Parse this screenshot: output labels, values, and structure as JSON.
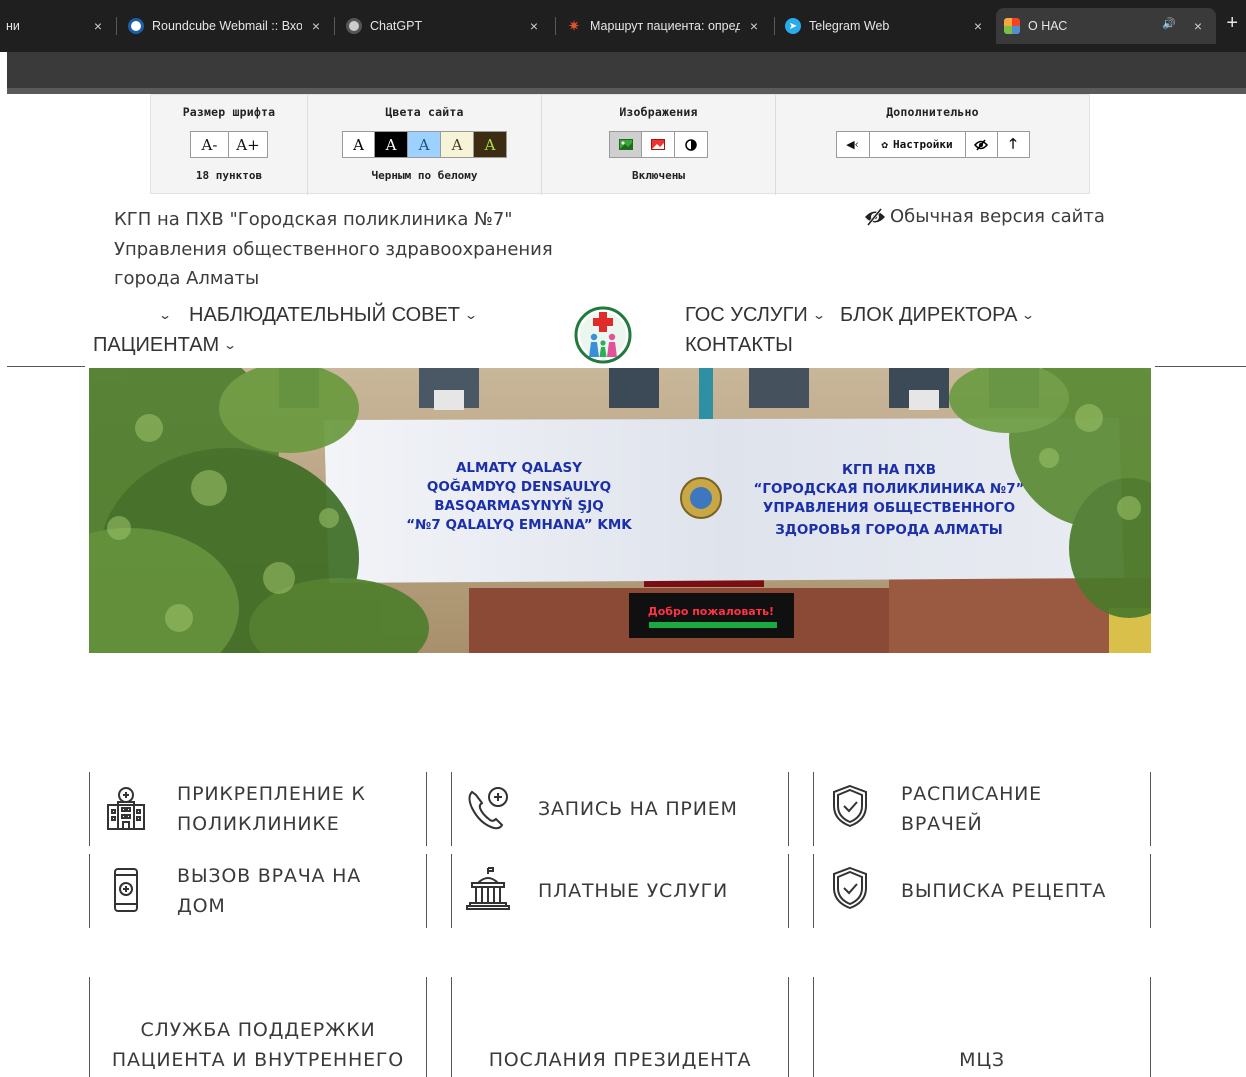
{
  "browser": {
    "tabs": [
      {
        "title": "ни",
        "favicon": "page-icon",
        "color": "#888888"
      },
      {
        "title": "Roundcube Webmail :: Вход",
        "favicon": "roundcube-icon",
        "color": "#1d5ea8"
      },
      {
        "title": "ChatGPT",
        "favicon": "chatgpt-icon",
        "color": "#cccccc"
      },
      {
        "title": "Маршрут пациента: определение",
        "favicon": "site-icon",
        "color": "#e0522a"
      },
      {
        "title": "Telegram Web",
        "favicon": "telegram-icon",
        "color": "#2aabee"
      },
      {
        "title": "О НАС",
        "favicon": "joomla-icon",
        "color": "#f44321"
      }
    ],
    "close_glyph": "×",
    "new_tab_glyph": "+",
    "audio_glyph": "🔊"
  },
  "accessibility": {
    "font_size": {
      "title": "Размер шрифта",
      "decrease": "A-",
      "increase": "A+",
      "status": "18 пунктов"
    },
    "colors": {
      "title": "Цвета сайта",
      "letter": "A",
      "status": "Черным по белому",
      "swatches": [
        {
          "bg": "#ffffff",
          "fg": "#000000"
        },
        {
          "bg": "#000000",
          "fg": "#ffffff"
        },
        {
          "bg": "#9dd1ff",
          "fg": "#1b4f86"
        },
        {
          "bg": "#f7f3d6",
          "fg": "#4b3a1e"
        },
        {
          "bg": "#3b2c12",
          "fg": "#a8e04a"
        }
      ]
    },
    "images": {
      "title": "Изображения",
      "status": "Включены"
    },
    "extra": {
      "title": "Дополнительно",
      "settings_label": "Настройки"
    }
  },
  "header": {
    "org_line1": "КГП на ПХВ \"Городская поликлиника №7\"",
    "org_line2": "Управления общественного здравоохранения",
    "org_line3": "города Алматы",
    "normal_version": "Обычная версия сайта"
  },
  "nav": {
    "council": "НАБЛЮДАТЕЛЬНЫЙ СОВЕТ",
    "patients": "ПАЦИЕНТАМ",
    "gov": "ГОС УСЛУГИ",
    "director": "БЛОК ДИРЕКТОРА",
    "contacts": "КОНТАКТЫ",
    "chevron": "⌄"
  },
  "hero": {
    "sign_left": [
      "ALMATY QALASY",
      "QOĞAMDYQ DENSAULYQ",
      "BASQARMASYNYŇ ŞJQ",
      "“№7 QALALYQ EMHANA” KMK"
    ],
    "sign_right": [
      "КГП НА ПХВ",
      "“ГОРОДСКАЯ ПОЛИКЛИНИКА №7”",
      "УПРАВЛЕНИЯ ОБЩЕСТВЕННОГО",
      "ЗДОРОВЬЯ ГОРОДА АЛМАТЫ"
    ],
    "led": "Добро пожаловать!"
  },
  "services": [
    {
      "line1": "ПРИКРЕПЛЕНИЕ К",
      "line2": "ПОЛИКЛИНИКЕ",
      "icon": "hospital-building-icon"
    },
    {
      "line1": "ЗАПИСЬ НА ПРИЕМ",
      "line2": "",
      "icon": "phone-medical-icon"
    },
    {
      "line1": "РАСПИСАНИЕ",
      "line2": "ВРАЧЕЙ",
      "icon": "shield-check-icon"
    },
    {
      "line1": "ВЫЗОВ ВРАЧА НА",
      "line2": "ДОМ",
      "icon": "mobile-medical-icon"
    },
    {
      "line1": "ПЛАТНЫЕ УСЛУГИ",
      "line2": "",
      "icon": "government-building-icon"
    },
    {
      "line1": "ВЫПИСКА РЕЦЕПТА",
      "line2": "",
      "icon": "shield-check-icon"
    }
  ],
  "boxes": [
    {
      "line1": "СЛУЖБА ПОДДЕРЖКИ",
      "line2": "ПАЦИЕНТА И ВНУТРЕННЕГО"
    },
    {
      "line1": "ПОСЛАНИЯ ПРЕЗИДЕНТА"
    },
    {
      "line1": "МЦЗ"
    }
  ]
}
